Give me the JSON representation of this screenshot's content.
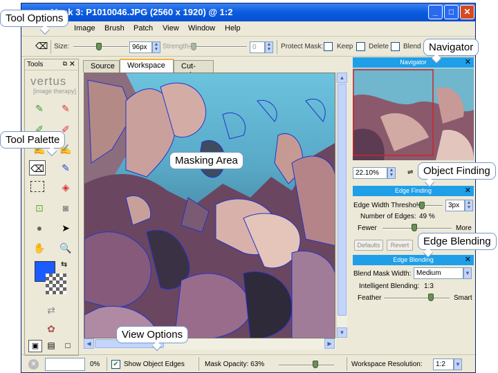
{
  "window": {
    "title": "Mask 3: P1010046.JPG (2560 x 1920) @ 1:2",
    "controls": [
      "_",
      "□",
      "✕"
    ]
  },
  "menu": [
    "Image",
    "Brush",
    "Patch",
    "View",
    "Window",
    "Help"
  ],
  "options": {
    "size_label": "Size:",
    "size_value": "96px",
    "strength_label": "Strength:",
    "strength_value": "0",
    "protect_mask_label": "Protect Mask:",
    "keep_label": "Keep",
    "delete_label": "Delete",
    "blend_label": "Blend"
  },
  "tools": {
    "header": "Tools",
    "logo": "vertus",
    "logo_sub": "[image therapy]"
  },
  "tabs": [
    "Source",
    "Workspace",
    "Cut-out"
  ],
  "navigator": {
    "title": "Navigator",
    "zoom_value": "22.10%"
  },
  "edge_finding": {
    "title": "Edge Finding",
    "threshold_label": "Edge Width Threshold:",
    "threshold_value": "3px",
    "num_edges_label": "Number of Edges:",
    "num_edges_value": "49 %",
    "fewer_label": "Fewer",
    "more_label": "More",
    "defaults_button": "Defaults",
    "revert_button": "Revert"
  },
  "edge_blending": {
    "title": "Edge Blending",
    "blend_width_label": "Blend Mask Width:",
    "blend_width_value": "Medium",
    "intelligent_label": "Intelligent Blending:",
    "intelligent_value": "1:3",
    "feather_label": "Feather",
    "smart_label": "Smart"
  },
  "status": {
    "progress_value": "0%",
    "show_edges_label": "Show Object Edges",
    "mask_opacity_label": "Mask Opacity: 63%",
    "workspace_res_label": "Workspace Resolution:",
    "workspace_res_value": "1:2"
  },
  "callouts": {
    "tool_options": "Tool Options",
    "tool_palette": "Tool Palette",
    "masking_area": "Masking Area",
    "view_options": "View Options",
    "navigator": "Navigator",
    "object_finding": "Object Finding",
    "edge_blending": "Edge Blending"
  },
  "colors": {
    "title_blue": "#0a5be0",
    "panel_header": "#1f9fe8",
    "primary_color_swatch": "#1a5cff",
    "edge_lines": "#2233cc"
  }
}
